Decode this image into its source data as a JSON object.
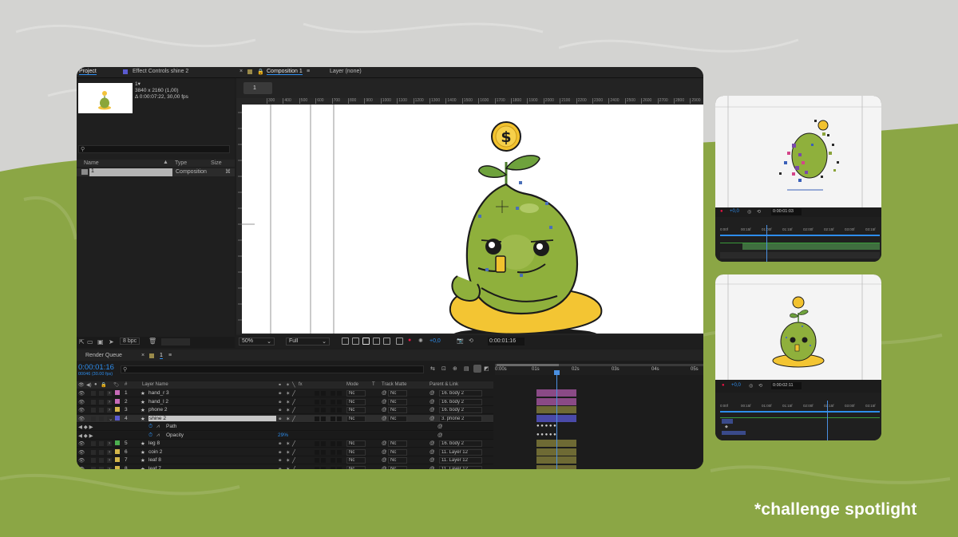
{
  "colors": {
    "bg_grey": "#d4d4d4",
    "bg_green": "#8aa546",
    "ae_panel": "#1d1d1d",
    "accent_blue": "#2d8ceb",
    "playhead": "#4a90e2",
    "yellow_bar": "#d8b53c",
    "pink_bar": "#8a4a86",
    "blue_bar": "#4a4aa8",
    "olive_bar": "#6e6a34"
  },
  "project": {
    "tab_project": "Project",
    "tab_effects": "Effect Controls shine 2",
    "comp_info": [
      "1▾",
      "3840 x 2160 (1,00)",
      "Δ 0:00:07:22, 30,00 fps"
    ],
    "search_placeholder": "",
    "columns": {
      "name": "Name",
      "type": "Type",
      "size": "Size"
    },
    "items": [
      {
        "name": "1",
        "type": "Composition"
      }
    ],
    "footer_bpc": "8 bpc"
  },
  "composition": {
    "tab_label": "Composition 1",
    "layer_tab": "Layer (none)",
    "breadcrumb": "1",
    "ruler_marks": [
      "300",
      "400",
      "500",
      "600",
      "700",
      "800",
      "900",
      "1000",
      "1100",
      "1200",
      "1300",
      "1400",
      "1500",
      "1600",
      "1700",
      "1800",
      "1900",
      "2000",
      "2100",
      "2200",
      "2300",
      "2400",
      "2500",
      "2600",
      "2700",
      "2800",
      "2900"
    ],
    "zoom": "50%",
    "resolution": "Full",
    "exposure": "+0,0",
    "timecode": "0:00:01:16",
    "coin_symbol": "$"
  },
  "timeline": {
    "tab_render_queue": "Render Queue",
    "tab_comp": "1",
    "current_time": "0:00:01:16",
    "frames": "00046 (30.00 fps)",
    "columns": {
      "num": "#",
      "layer_name": "Layer Name",
      "mode": "Mode",
      "t": "T",
      "track_matte": "Track Matte",
      "parent": "Parent & Link"
    },
    "time_marks": [
      "0:00s",
      "01s",
      "02s",
      "03s",
      "04s",
      "05s"
    ],
    "layers": [
      {
        "num": "1",
        "name": "hand_r 3",
        "color": "#c76bb8",
        "mode": "Nc",
        "matte": "Nc",
        "parent": "16. body 2",
        "bar": "pink"
      },
      {
        "num": "2",
        "name": "hand_l 2",
        "color": "#c76bb8",
        "mode": "Nc",
        "matte": "Nc",
        "parent": "16. body 2",
        "bar": "pink"
      },
      {
        "num": "3",
        "name": "phone 2",
        "color": "#d4b64a",
        "mode": "Nc",
        "matte": "Nc",
        "parent": "16. body 2",
        "bar": "olive"
      },
      {
        "num": "4",
        "name": "shine 2",
        "color": "#5a5ad0",
        "mode": "Nc",
        "matte": "Nc",
        "parent": "3. phone 2",
        "bar": "blue",
        "selected": true
      },
      {
        "num": "5",
        "name": "leg 8",
        "color": "#4caf50",
        "mode": "Nc",
        "matte": "Nc",
        "parent": "16. body 2",
        "bar": "olive"
      },
      {
        "num": "6",
        "name": "coin 2",
        "color": "#d4b64a",
        "mode": "Nc",
        "matte": "Nc",
        "parent": "11. Layer 12",
        "bar": "olive"
      },
      {
        "num": "7",
        "name": "leaf 8",
        "color": "#d4b64a",
        "mode": "Nc",
        "matte": "Nc",
        "parent": "11. Layer 12",
        "bar": "olive"
      },
      {
        "num": "8",
        "name": "leaf 7",
        "color": "#d4b64a",
        "mode": "Nc",
        "matte": "Nc",
        "parent": "11. Layer 12",
        "bar": "olive"
      }
    ],
    "sub_path": "Path",
    "sub_opacity": "Opacity",
    "opacity_value": "29%"
  },
  "thumb1": {
    "exposure": "+0,0",
    "timecode": "0:00:01:03",
    "marks": [
      "0:00f",
      "00:15f",
      "01:00f",
      "01:15f",
      "02:00f",
      "02:15f",
      "03:00f",
      "03:15f"
    ]
  },
  "thumb2": {
    "exposure": "+0,0",
    "timecode": "0:00:02:11",
    "marks": [
      "0:00f",
      "00:15f",
      "01:00f",
      "01:15f",
      "02:00f",
      "02:15f",
      "03:00f",
      "03:15f"
    ]
  },
  "caption": "*challenge spotlight"
}
